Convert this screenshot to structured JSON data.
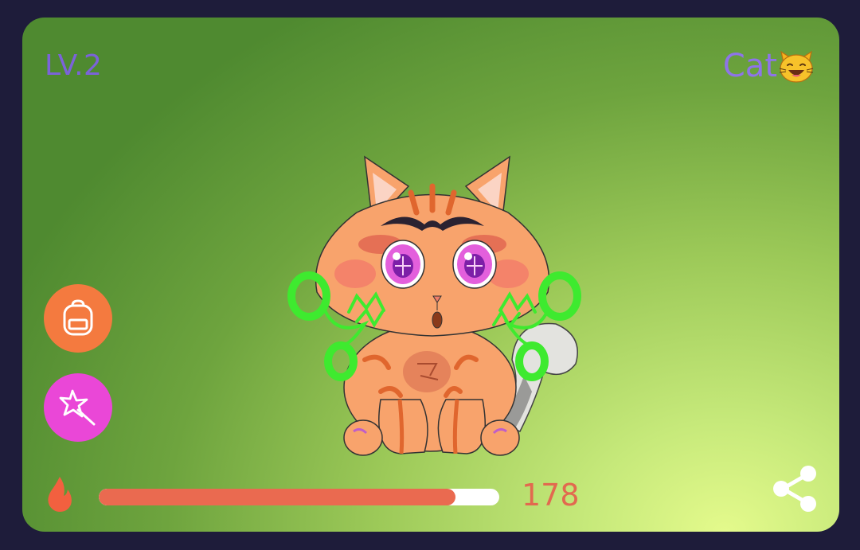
{
  "level": "LV.2",
  "pet": {
    "name": "Cat",
    "emoji_icon": "cat-face-icon"
  },
  "actions": {
    "backpack_icon": "backpack-icon",
    "magic_icon": "magic-wand-icon",
    "share_icon": "share-icon"
  },
  "energy": {
    "icon": "flame-icon",
    "value": "178",
    "fill_fraction": 0.89
  },
  "colors": {
    "level_text": "#7b63d9",
    "name_text": "#8e74e8",
    "backpack_button": "#f47a3f",
    "magic_button": "#ea47d7",
    "bar_fill": "#ea6a50",
    "bar_track": "#ffffff",
    "value_text": "#e2694f",
    "background_dark": "#1e1c3a"
  }
}
